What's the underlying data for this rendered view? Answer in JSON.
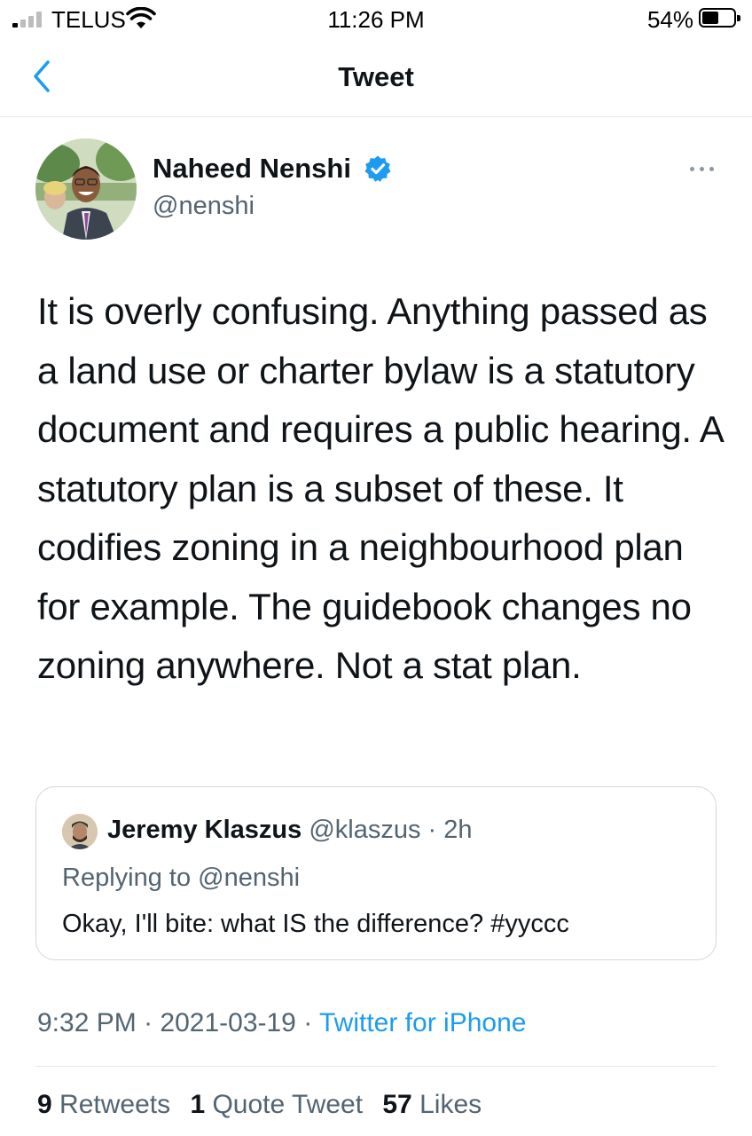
{
  "status_bar": {
    "carrier": "TELUS",
    "time": "11:26 PM",
    "battery": "54%",
    "battery_level": 0.54
  },
  "nav": {
    "title": "Tweet"
  },
  "tweet": {
    "author_name": "Naheed Nenshi",
    "author_handle": "@nenshi",
    "text": "It is overly confusing. Anything passed as a land use or charter bylaw is a statutory document and requires a public hearing. A statutory plan is a subset of these. It codifies zoning in a neighbourhood plan for example. The guidebook changes no zoning anywhere. Not a stat plan.",
    "time": "9:32 PM",
    "date": "2021-03-19",
    "source": "Twitter for iPhone",
    "separator": " · "
  },
  "quote": {
    "author_name": "Jeremy Klaszus",
    "author_handle": "@klaszus",
    "age": "2h",
    "replying_label": "Replying to ",
    "replying_to": "@nenshi",
    "text": "Okay, I'll bite: what IS the difference? #yyccc"
  },
  "stats": {
    "retweets_count": "9",
    "retweets_label": "Retweets",
    "quotes_count": "1",
    "quotes_label": "Quote Tweet",
    "likes_count": "57",
    "likes_label": "Likes"
  },
  "colors": {
    "accent": "#1d9bf0",
    "text_primary": "#0f1419",
    "text_secondary": "#536471",
    "border": "#cfd9de"
  },
  "icons": {
    "back": "chevron-left-icon",
    "verified": "verified-badge-icon",
    "more": "more-horizontal-icon",
    "signal": "cellular-signal-icon",
    "wifi": "wifi-icon",
    "battery": "battery-icon"
  }
}
